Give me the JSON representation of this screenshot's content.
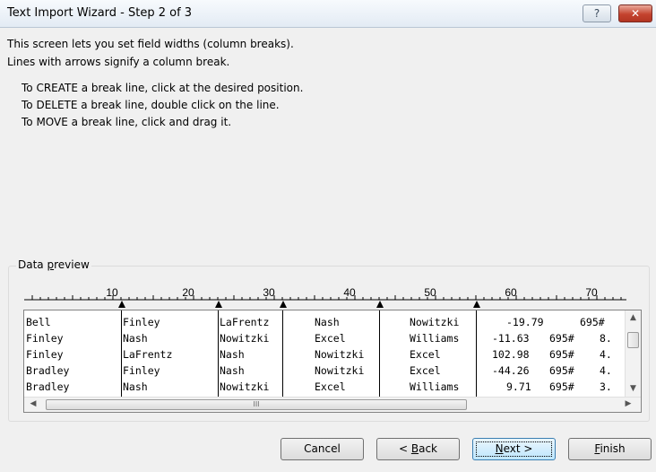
{
  "window": {
    "title": "Text Import Wizard - Step 2 of 3",
    "help_label": "?",
    "close_label": "✕"
  },
  "instructions": {
    "line1": "This screen lets you set field widths (column breaks).",
    "line2": "Lines with arrows signify a column break.",
    "create": "To CREATE a break line, click at the desired position.",
    "delete": "To DELETE a break line, double click on the line.",
    "move": "To MOVE a break line, click and drag it."
  },
  "preview": {
    "label_prefix": "Data ",
    "label_mnemonic": "p",
    "label_rest": "review",
    "ruler_labels": [
      "10",
      "20",
      "30",
      "40",
      "50",
      "60",
      "70"
    ],
    "rows": [
      [
        "Bell",
        "Finley",
        "LaFrentz",
        "Nash",
        "Nowitzki",
        "-19.79",
        "695#",
        ""
      ],
      [
        "Finley",
        "Nash",
        "Nowitzki",
        "Excel",
        "Williams",
        "-11.63",
        "695#",
        "8."
      ],
      [
        "Finley",
        "LaFrentz",
        "Nash",
        "Nowitzki",
        "Excel",
        "102.98",
        "695#",
        "4."
      ],
      [
        "Bradley",
        "Finley",
        "Nash",
        "Nowitzki",
        "Excel",
        "-44.26",
        "695#",
        "4."
      ],
      [
        "Bradley",
        "Nash",
        "Nowitzki",
        "Excel",
        "Williams",
        "9.71",
        "695#",
        "3."
      ]
    ],
    "hscroll_grip": "III"
  },
  "buttons": {
    "cancel": "Cancel",
    "back_prefix": "< ",
    "back_mnemonic": "B",
    "back_rest": "ack",
    "next_mnemonic": "N",
    "next_rest": "ext >",
    "finish_mnemonic": "F",
    "finish_rest": "inish"
  },
  "icons": {
    "up": "scroll-up-arrow-icon",
    "down": "scroll-down-arrow-icon",
    "left": "scroll-left-arrow-icon",
    "right": "scroll-right-arrow-icon"
  }
}
